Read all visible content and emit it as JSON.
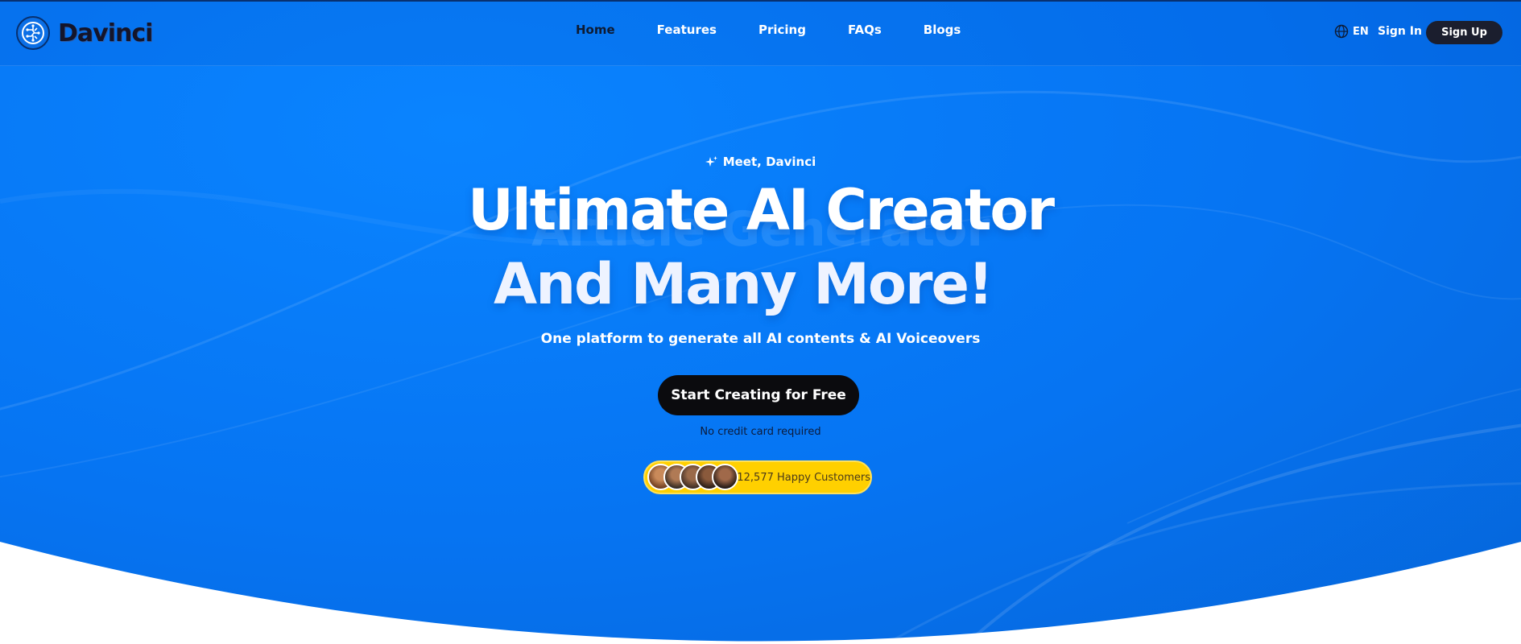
{
  "brand": {
    "name": "Davinci"
  },
  "nav": {
    "items": [
      {
        "label": "Home",
        "active": true
      },
      {
        "label": "Features",
        "active": false
      },
      {
        "label": "Pricing",
        "active": false
      },
      {
        "label": "FAQs",
        "active": false
      },
      {
        "label": "Blogs",
        "active": false
      }
    ]
  },
  "header": {
    "language": "EN",
    "sign_in": "Sign In",
    "sign_up": "Sign Up"
  },
  "hero": {
    "eyebrow": "Meet, Davinci",
    "ghost_text": "Article Generator",
    "title_line1": "Ultimate AI Creator",
    "title_line2": "And Many More!",
    "subtitle": "One platform to generate all AI contents & AI Voiceovers",
    "cta": "Start Creating for Free",
    "cta_note": "No credit card required",
    "customers_label": "12,577 Happy Customers"
  },
  "colors": {
    "hero_blue": "#0674f2",
    "dark_button": "#0b0b0e",
    "badge_yellow": "#ffd000"
  }
}
